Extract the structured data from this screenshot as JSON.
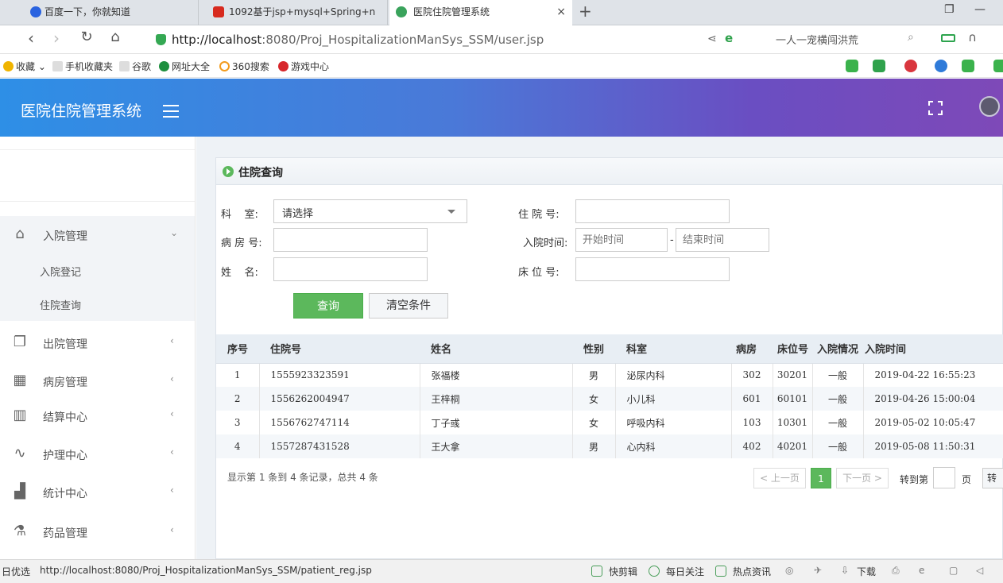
{
  "browser": {
    "tabs": [
      {
        "label": "百度一下，你就知道"
      },
      {
        "label": "1092基于jsp+mysql+Spring+n"
      },
      {
        "label": "医院住院管理系统"
      }
    ],
    "tab_close": "×",
    "new_tab": "+",
    "url_host": "http://localhost",
    "url_rest": ":8080/Proj_HospitalizationManSys_SSM/user.jsp",
    "search_hint": "一人一宠横闯洪荒",
    "bookmarks": [
      "收藏",
      "手机收藏夹",
      "谷歌",
      "网址大全",
      "360搜索",
      "游戏中心"
    ],
    "status_left": "日优选",
    "status_url": "http://localhost:8080/Proj_HospitalizationManSys_SSM/patient_reg.jsp",
    "status_items": [
      "快剪辑",
      "每日关注",
      "热点资讯",
      "下载"
    ]
  },
  "app": {
    "title": "医院住院管理系统"
  },
  "sidebar": {
    "groups": [
      {
        "label": "入院管理",
        "icon": "home-icon",
        "expanded": true,
        "children": [
          "入院登记",
          "住院查询"
        ]
      },
      {
        "label": "出院管理",
        "icon": "discharge-icon"
      },
      {
        "label": "病房管理",
        "icon": "building-icon"
      },
      {
        "label": "结算中心",
        "icon": "map-icon"
      },
      {
        "label": "护理中心",
        "icon": "trend-icon"
      },
      {
        "label": "统计中心",
        "icon": "bar-chart-icon"
      },
      {
        "label": "药品管理",
        "icon": "flask-icon"
      }
    ]
  },
  "panel": {
    "title": "住院查询"
  },
  "form": {
    "dept_label": "科    室:",
    "dept_value": "请选择",
    "room_label": "病 房 号:",
    "name_label": "姓    名:",
    "hosp_label": "住 院 号:",
    "time_label": "入院时间:",
    "start_placeholder": "开始时间",
    "time_sep": "-",
    "end_placeholder": "结束时间",
    "bed_label": "床 位 号:",
    "query_btn": "查询",
    "clear_btn": "清空条件"
  },
  "table": {
    "headers": [
      "序号",
      "住院号",
      "姓名",
      "性别",
      "科室",
      "病房",
      "床位号",
      "入院情况",
      "入院时间"
    ],
    "rows": [
      [
        "1",
        "1555923323591",
        "张福楼",
        "男",
        "泌尿内科",
        "302",
        "30201",
        "一般",
        "2019-04-22 16:55:23"
      ],
      [
        "2",
        "1556262004947",
        "王梓桐",
        "女",
        "小儿科",
        "601",
        "60101",
        "一般",
        "2019-04-26 15:00:04"
      ],
      [
        "3",
        "1556762747114",
        "丁子彧",
        "女",
        "呼吸内科",
        "103",
        "10301",
        "一般",
        "2019-05-02 10:05:47"
      ],
      [
        "4",
        "1557287431528",
        "王大拿",
        "男",
        "心内科",
        "402",
        "40201",
        "一般",
        "2019-05-08 11:50:31"
      ]
    ]
  },
  "pagination": {
    "info": "显示第 1 条到 4 条记录，总共 4 条",
    "prev": "< 上一页",
    "current": "1",
    "next": "下一页 >",
    "goto_label": "转到第",
    "page_unit": "页",
    "go_btn": "转"
  }
}
